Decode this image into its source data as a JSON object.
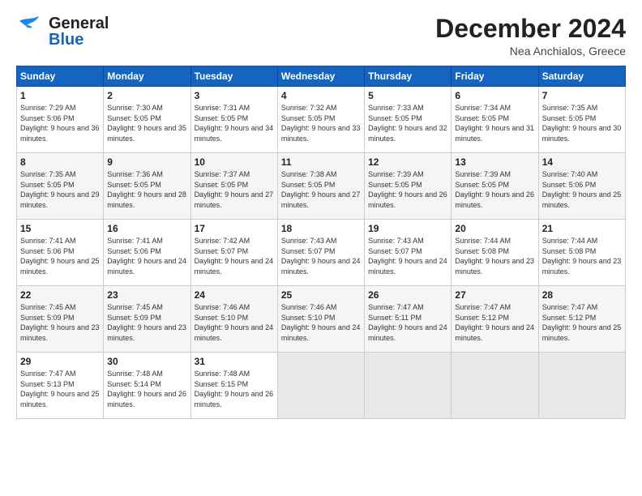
{
  "header": {
    "logo_line1": "General",
    "logo_line2": "Blue",
    "month": "December 2024",
    "location": "Nea Anchialos, Greece"
  },
  "weekdays": [
    "Sunday",
    "Monday",
    "Tuesday",
    "Wednesday",
    "Thursday",
    "Friday",
    "Saturday"
  ],
  "weeks": [
    [
      {
        "day": "1",
        "sunrise": "7:29 AM",
        "sunset": "5:06 PM",
        "daylight": "9 hours and 36 minutes."
      },
      {
        "day": "2",
        "sunrise": "7:30 AM",
        "sunset": "5:05 PM",
        "daylight": "9 hours and 35 minutes."
      },
      {
        "day": "3",
        "sunrise": "7:31 AM",
        "sunset": "5:05 PM",
        "daylight": "9 hours and 34 minutes."
      },
      {
        "day": "4",
        "sunrise": "7:32 AM",
        "sunset": "5:05 PM",
        "daylight": "9 hours and 33 minutes."
      },
      {
        "day": "5",
        "sunrise": "7:33 AM",
        "sunset": "5:05 PM",
        "daylight": "9 hours and 32 minutes."
      },
      {
        "day": "6",
        "sunrise": "7:34 AM",
        "sunset": "5:05 PM",
        "daylight": "9 hours and 31 minutes."
      },
      {
        "day": "7",
        "sunrise": "7:35 AM",
        "sunset": "5:05 PM",
        "daylight": "9 hours and 30 minutes."
      }
    ],
    [
      {
        "day": "8",
        "sunrise": "7:35 AM",
        "sunset": "5:05 PM",
        "daylight": "9 hours and 29 minutes."
      },
      {
        "day": "9",
        "sunrise": "7:36 AM",
        "sunset": "5:05 PM",
        "daylight": "9 hours and 28 minutes."
      },
      {
        "day": "10",
        "sunrise": "7:37 AM",
        "sunset": "5:05 PM",
        "daylight": "9 hours and 27 minutes."
      },
      {
        "day": "11",
        "sunrise": "7:38 AM",
        "sunset": "5:05 PM",
        "daylight": "9 hours and 27 minutes."
      },
      {
        "day": "12",
        "sunrise": "7:39 AM",
        "sunset": "5:05 PM",
        "daylight": "9 hours and 26 minutes."
      },
      {
        "day": "13",
        "sunrise": "7:39 AM",
        "sunset": "5:05 PM",
        "daylight": "9 hours and 26 minutes."
      },
      {
        "day": "14",
        "sunrise": "7:40 AM",
        "sunset": "5:06 PM",
        "daylight": "9 hours and 25 minutes."
      }
    ],
    [
      {
        "day": "15",
        "sunrise": "7:41 AM",
        "sunset": "5:06 PM",
        "daylight": "9 hours and 25 minutes."
      },
      {
        "day": "16",
        "sunrise": "7:41 AM",
        "sunset": "5:06 PM",
        "daylight": "9 hours and 24 minutes."
      },
      {
        "day": "17",
        "sunrise": "7:42 AM",
        "sunset": "5:07 PM",
        "daylight": "9 hours and 24 minutes."
      },
      {
        "day": "18",
        "sunrise": "7:43 AM",
        "sunset": "5:07 PM",
        "daylight": "9 hours and 24 minutes."
      },
      {
        "day": "19",
        "sunrise": "7:43 AM",
        "sunset": "5:07 PM",
        "daylight": "9 hours and 24 minutes."
      },
      {
        "day": "20",
        "sunrise": "7:44 AM",
        "sunset": "5:08 PM",
        "daylight": "9 hours and 23 minutes."
      },
      {
        "day": "21",
        "sunrise": "7:44 AM",
        "sunset": "5:08 PM",
        "daylight": "9 hours and 23 minutes."
      }
    ],
    [
      {
        "day": "22",
        "sunrise": "7:45 AM",
        "sunset": "5:09 PM",
        "daylight": "9 hours and 23 minutes."
      },
      {
        "day": "23",
        "sunrise": "7:45 AM",
        "sunset": "5:09 PM",
        "daylight": "9 hours and 23 minutes."
      },
      {
        "day": "24",
        "sunrise": "7:46 AM",
        "sunset": "5:10 PM",
        "daylight": "9 hours and 24 minutes."
      },
      {
        "day": "25",
        "sunrise": "7:46 AM",
        "sunset": "5:10 PM",
        "daylight": "9 hours and 24 minutes."
      },
      {
        "day": "26",
        "sunrise": "7:47 AM",
        "sunset": "5:11 PM",
        "daylight": "9 hours and 24 minutes."
      },
      {
        "day": "27",
        "sunrise": "7:47 AM",
        "sunset": "5:12 PM",
        "daylight": "9 hours and 24 minutes."
      },
      {
        "day": "28",
        "sunrise": "7:47 AM",
        "sunset": "5:12 PM",
        "daylight": "9 hours and 25 minutes."
      }
    ],
    [
      {
        "day": "29",
        "sunrise": "7:47 AM",
        "sunset": "5:13 PM",
        "daylight": "9 hours and 25 minutes."
      },
      {
        "day": "30",
        "sunrise": "7:48 AM",
        "sunset": "5:14 PM",
        "daylight": "9 hours and 26 minutes."
      },
      {
        "day": "31",
        "sunrise": "7:48 AM",
        "sunset": "5:15 PM",
        "daylight": "9 hours and 26 minutes."
      },
      null,
      null,
      null,
      null
    ]
  ]
}
